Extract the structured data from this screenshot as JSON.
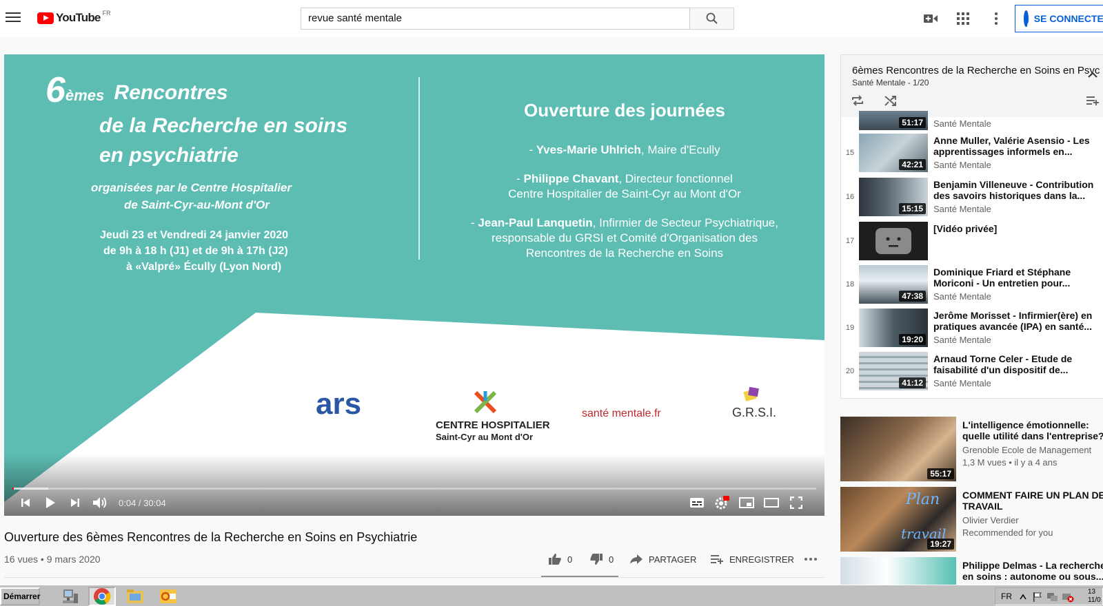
{
  "header": {
    "logo_text": "YouTube",
    "logo_region": "FR",
    "search_value": "revue santé mentale",
    "signin_label": "SE CONNECTER"
  },
  "slide": {
    "title_number": "6",
    "title_sup": "èmes",
    "title_line1": "Rencontres",
    "title_line2": "de la Recherche en soins",
    "title_line3": "en psychiatrie",
    "organizer_line1": "organisées par le Centre Hospitalier",
    "organizer_line2": "de Saint-Cyr-au-Mont d'Or",
    "dates_line1": "Jeudi 23 et Vendredi 24 janvier 2020",
    "dates_line2": "de 9h à 18 h (J1) et de 9h à 17h (J2)",
    "dates_line3": "à «Valpré» Écully (Lyon Nord)",
    "right_title": "Ouverture des journées",
    "speaker1_name": "Yves-Marie Uhlrich",
    "speaker1_role": ", Maire d'Ecully",
    "speaker2_name": "Philippe Chavant",
    "speaker2_role": ", Directeur fonctionnel",
    "speaker2_role2": "Centre Hospitalier de Saint-Cyr au Mont d'Or",
    "speaker3_name": "Jean-Paul Lanquetin",
    "speaker3_role": ", Infirmier de Secteur Psychiatrique,",
    "speaker3_role2": "responsable du GRSI et Comité d'Organisation des",
    "speaker3_role3": "Rencontres de la Recherche en Soins",
    "logo_ars": "ars",
    "logo_ch_line1": "CENTRE HOSPITALIER",
    "logo_ch_line2": "Saint-Cyr au Mont d'Or",
    "logo_sm": "santé mentale.fr",
    "logo_grsi": "G.R.S.I."
  },
  "player": {
    "timecode": "0:04 / 30:04",
    "progress": 0.002,
    "buffered": 0.045
  },
  "video": {
    "title": "Ouverture des 6èmes Rencontres de la Recherche en Soins en Psychiatrie",
    "meta": "16 vues • 9 mars 2020",
    "likes": "0",
    "dislikes": "0",
    "share": "PARTAGER",
    "save": "ENREGISTRER"
  },
  "playlist": {
    "title": "6èmes Rencontres de la Recherche en Soins en Psyc",
    "subtitle": "Santé Mentale - 1/20",
    "items": [
      {
        "num": "",
        "name": "",
        "channel": "Santé Mentale",
        "duration": "51:17"
      },
      {
        "num": "15",
        "name": "Anne Muller, Valérie Asensio - Les apprentissages informels en...",
        "channel": "Santé Mentale",
        "duration": "42:21"
      },
      {
        "num": "16",
        "name": "Benjamin Villeneuve - Contribution des savoirs historiques dans la...",
        "channel": "Santé Mentale",
        "duration": "15:15"
      },
      {
        "num": "17",
        "name": "[Vidéo privée]",
        "channel": "",
        "duration": ""
      },
      {
        "num": "18",
        "name": "Dominique Friard et Stéphane Moriconi - Un entretien pour...",
        "channel": "Santé Mentale",
        "duration": "47:38"
      },
      {
        "num": "19",
        "name": "Jerôme Morisset - Infirmier(ère) en pratiques avancée (IPA) en santé...",
        "channel": "Santé Mentale",
        "duration": "19:20"
      },
      {
        "num": "20",
        "name": "Arnaud Torne Celer - Etude de faisabilité d'un dispositif de...",
        "channel": "Santé Mentale",
        "duration": "41:12"
      }
    ]
  },
  "recommendations": [
    {
      "title": "L'intelligence émotionnelle: quelle utilité dans l'entreprise?",
      "channel": "Grenoble Ecole de Management",
      "views": "1,3 M vues • il y a 4 ans",
      "duration": "55:17"
    },
    {
      "title": "COMMENT FAIRE UN PLAN DE TRAVAIL",
      "channel": "Olivier Verdier",
      "views": "Recommended for you",
      "duration": "19:27"
    },
    {
      "title": "Philippe Delmas - La recherche en soins : autonome ou sous...",
      "channel": "",
      "views": "",
      "duration": ""
    }
  ],
  "taskbar": {
    "start_label": "Démarrer",
    "lang": "FR",
    "clock_line1": "13",
    "clock_line2": "11/0"
  },
  "colors": {
    "youtube_red": "#ff0000",
    "slide_teal": "#5dbdb3",
    "signin_blue": "#065fd4"
  }
}
